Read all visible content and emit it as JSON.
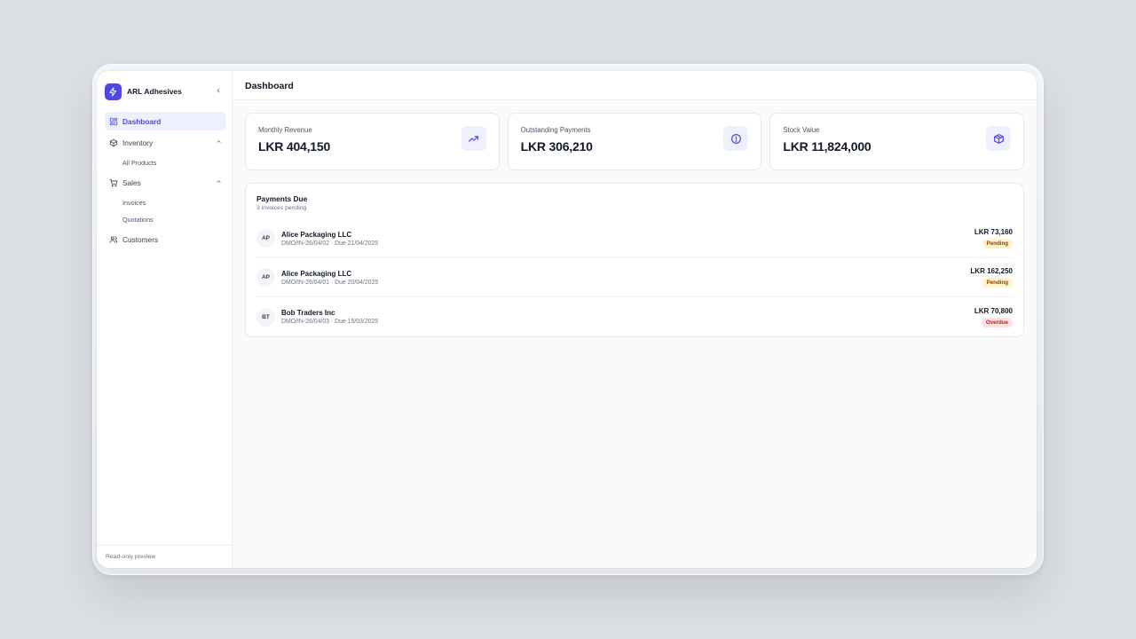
{
  "app": {
    "name": "ARL Adhesives",
    "page_title": "Dashboard"
  },
  "sidebar": {
    "items": [
      {
        "label": "Dashboard",
        "icon": "grid-icon",
        "active": true
      },
      {
        "label": "Inventory",
        "icon": "box-icon",
        "expanded": true,
        "children": [
          "All Products"
        ]
      },
      {
        "label": "Sales",
        "icon": "cart-icon",
        "expanded": true,
        "children": [
          "Invoices",
          "Quotations"
        ]
      },
      {
        "label": "Customers",
        "icon": "users-icon"
      }
    ],
    "footer": "Read-only preview"
  },
  "stats": [
    {
      "label": "Monthly Revenue",
      "value": "LKR 404,150",
      "icon": "trending-up-icon"
    },
    {
      "label": "Outstanding Payments",
      "value": "LKR 306,210",
      "icon": "alert-circle-icon"
    },
    {
      "label": "Stock Value",
      "value": "LKR 11,824,000",
      "icon": "package-icon"
    }
  ],
  "payments": {
    "title": "Payments Due",
    "subtitle": "3 invoices pending",
    "rows": [
      {
        "initials": "AP",
        "name": "Alice Packaging LLC",
        "meta": "DMO/IN-26/04/02 · Due 21/04/2025",
        "amount": "LKR 73,160",
        "status": "Pending"
      },
      {
        "initials": "AP",
        "name": "Alice Packaging LLC",
        "meta": "DMO/IN-26/04/01 · Due 20/04/2025",
        "amount": "LKR 162,250",
        "status": "Pending"
      },
      {
        "initials": "BT",
        "name": "Bob Traders Inc",
        "meta": "DMO/IN-26/04/03 · Due 15/03/2025",
        "amount": "LKR 70,800",
        "status": "Overdue"
      }
    ]
  },
  "colors": {
    "accent": "#4f46e5",
    "accent_bg": "#eef0fd",
    "pending_bg": "#fef3c7",
    "pending_fg": "#92400e",
    "overdue_bg": "#fee2e2",
    "overdue_fg": "#b91c1c"
  }
}
